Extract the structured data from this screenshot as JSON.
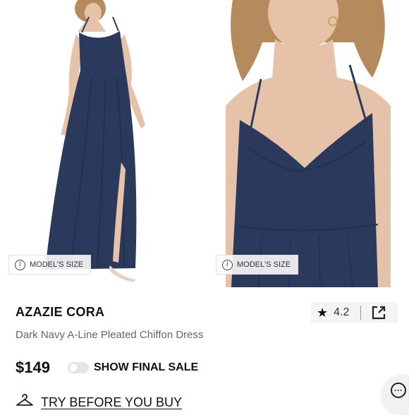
{
  "gallery": {
    "model_size_label": "MODEL'S SIZE",
    "dress_color": "#2b3a5c",
    "skin_color": "#e6c3a8",
    "hair_color": "#b58a5c"
  },
  "product": {
    "brand": "AZAZIE CORA",
    "name": "Dark Navy A-Line Pleated Chiffon Dress",
    "price": "$149",
    "rating": "4.2"
  },
  "options": {
    "final_sale_label": "SHOW FINAL SALE",
    "final_sale_enabled": false
  },
  "try_before": {
    "label": "TRY BEFORE YOU BUY"
  },
  "icons": {
    "info": "i",
    "star": "★",
    "chat": "···"
  }
}
